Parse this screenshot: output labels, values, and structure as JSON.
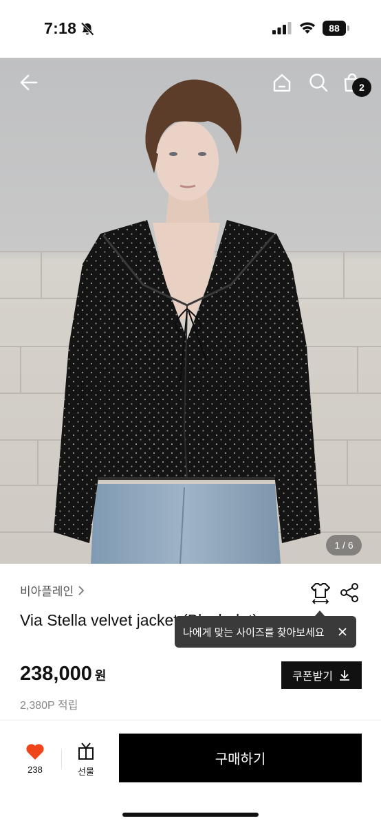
{
  "status": {
    "time": "7:18",
    "battery": "88"
  },
  "header": {
    "cart_count": "2"
  },
  "gallery": {
    "counter": "1 / 6"
  },
  "product": {
    "brand": "비아플레인",
    "title": "Via Stella velvet jacket (Black dot)",
    "price": "238,000",
    "price_unit": "원",
    "points": "2,380P 적립"
  },
  "tooltip": {
    "text": "나에게 맞는 사이즈를 찾아보세요"
  },
  "coupon": {
    "label": "쿠폰받기"
  },
  "bottom_bar": {
    "like_count": "238",
    "gift_label": "선물",
    "buy_label": "구매하기",
    "like_color": "#f0441a"
  },
  "icons": [
    "back-arrow-icon",
    "home-icon",
    "search-icon",
    "shopping-bag-icon",
    "size-guide-icon",
    "share-icon",
    "close-icon",
    "download-icon",
    "heart-icon",
    "gift-icon",
    "bell-muted-icon",
    "signal-icon",
    "wifi-icon",
    "battery-icon"
  ]
}
